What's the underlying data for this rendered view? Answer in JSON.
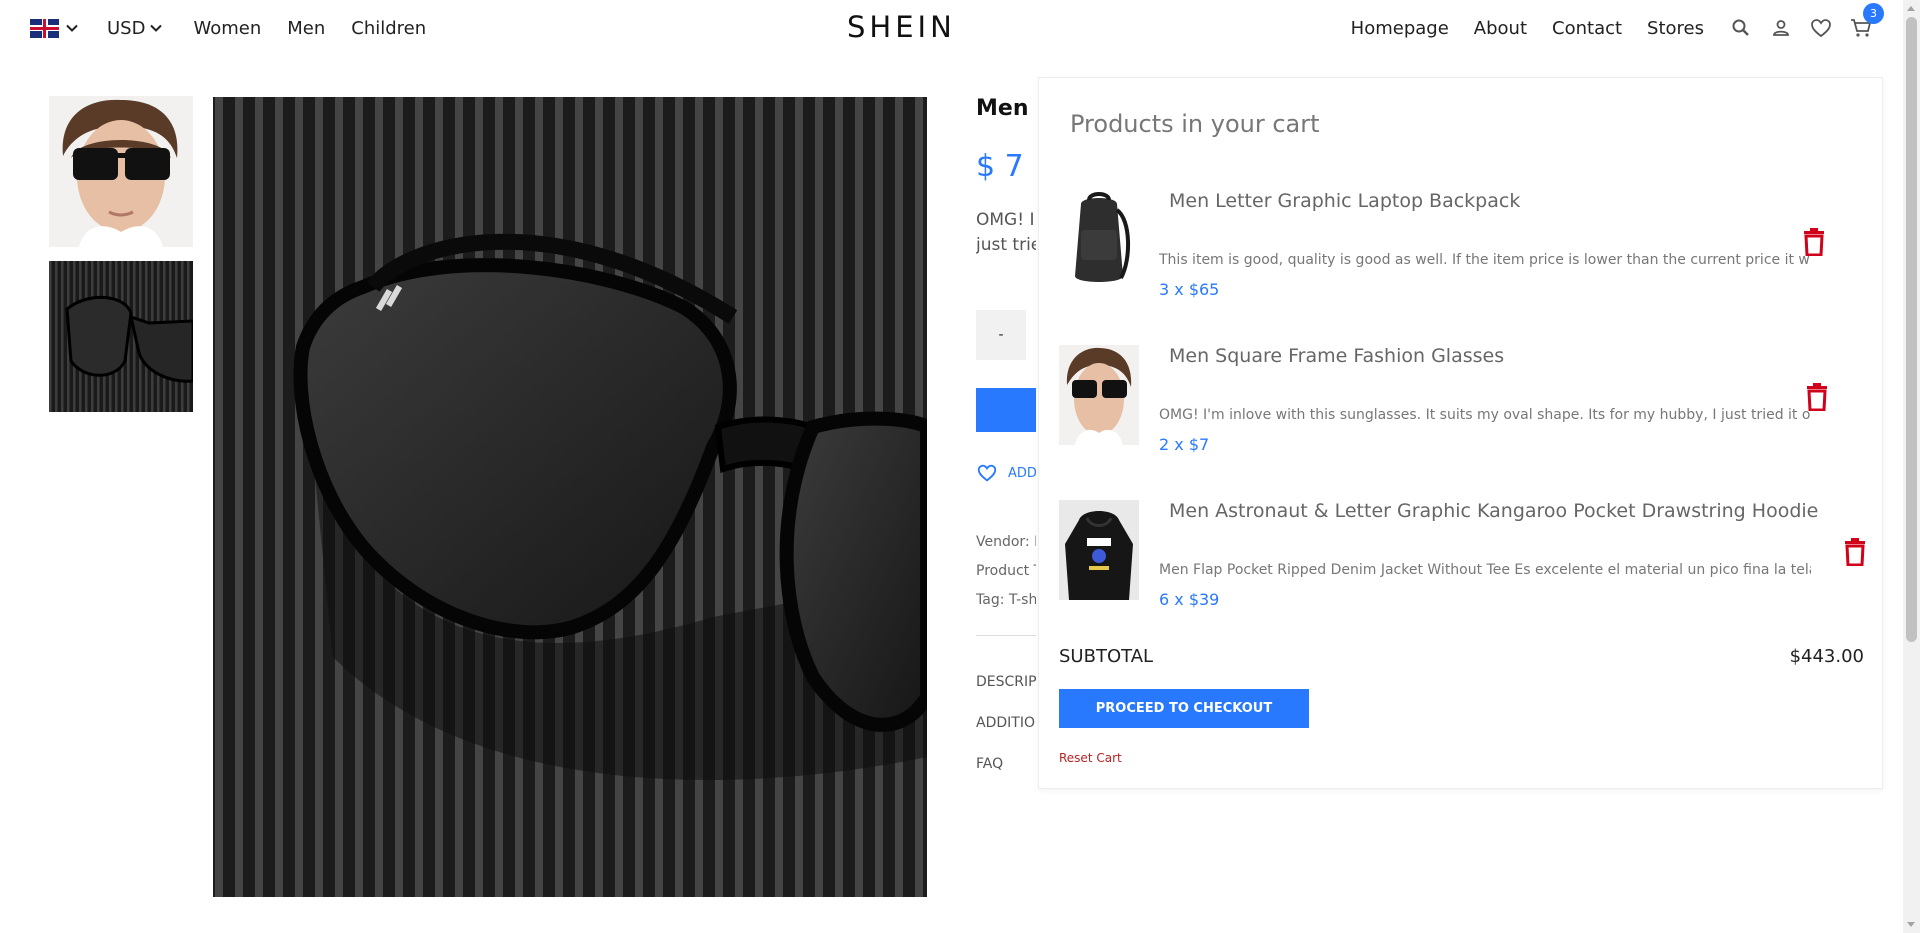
{
  "nav": {
    "currency": "USD",
    "left_links": [
      "Women",
      "Men",
      "Children"
    ],
    "logo": "SHEIN",
    "right_links": [
      "Homepage",
      "About",
      "Contact",
      "Stores"
    ],
    "cart_count": "3"
  },
  "product": {
    "title": "Men Square Frame Fashion Glasses",
    "price": "$ 7",
    "description": "OMG! I'm inlove with this sunglasses. It suits my oval shape. Its for my hubby, I just tried it on. It looks good on",
    "qty_minus": "-",
    "wishlist_label": "ADD TO WISHLIST",
    "vendor": "Vendor: Polo",
    "product_type": "Product Type: Glasses",
    "tag": "Tag: T-shirt",
    "accordion": [
      "DESCRIPTION",
      "ADDITIONAL INFORMATION",
      "FAQ"
    ]
  },
  "cart": {
    "heading": "Products in your cart",
    "items": [
      {
        "title": "Men Letter Graphic Laptop Backpack",
        "desc": "This item is good, quality is good as well. If the item price is lower than the current price it wil",
        "qty_price": "3 x $65"
      },
      {
        "title": "Men Square Frame Fashion Glasses",
        "desc": "OMG! I'm inlove with this sunglasses. It suits my oval shape. Its for my hubby, I just tried it on.",
        "qty_price": "2 x $7"
      },
      {
        "title": "Men Astronaut & Letter Graphic Kangaroo Pocket Drawstring Hoodie",
        "desc": "Men Flap Pocket Ripped Denim Jacket Without Tee Es excelente el material un pico fina la tela pero e",
        "qty_price": "6 x $39"
      }
    ],
    "subtotal_label": "SUBTOTAL",
    "subtotal_value": "$443.00",
    "checkout_label": "PROCEED TO CHECKOUT",
    "reset_label": "Reset Cart"
  },
  "colors": {
    "accent": "#2879fe",
    "trash": "#d0021b"
  }
}
